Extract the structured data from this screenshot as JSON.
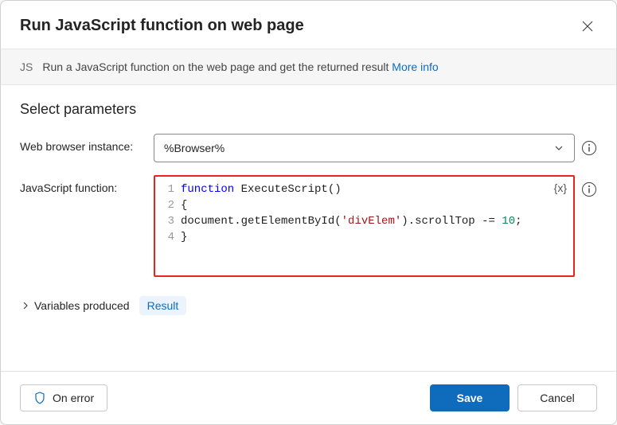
{
  "header": {
    "title": "Run JavaScript function on web page"
  },
  "banner": {
    "badge": "JS",
    "text": "Run a JavaScript function on the web page and get the returned result ",
    "link_label": "More info"
  },
  "section": {
    "title": "Select parameters"
  },
  "params": {
    "browser_label": "Web browser instance:",
    "browser_value": "%Browser%",
    "js_label": "JavaScript function:",
    "var_badge": "{x}",
    "code": {
      "line1": {
        "num": "1",
        "keyword": "function",
        "rest": " ExecuteScript()"
      },
      "line2": {
        "num": "2",
        "content": "{"
      },
      "line3": {
        "num": "3",
        "prefix": "document.getElementById(",
        "str": "'divElem'",
        "suffix": ").scrollTop -= ",
        "number": "10",
        "end": ";"
      },
      "line4": {
        "num": "4",
        "content": "}"
      }
    }
  },
  "variables": {
    "label": "Variables produced",
    "result_badge": "Result"
  },
  "footer": {
    "on_error": "On error",
    "save": "Save",
    "cancel": "Cancel"
  }
}
